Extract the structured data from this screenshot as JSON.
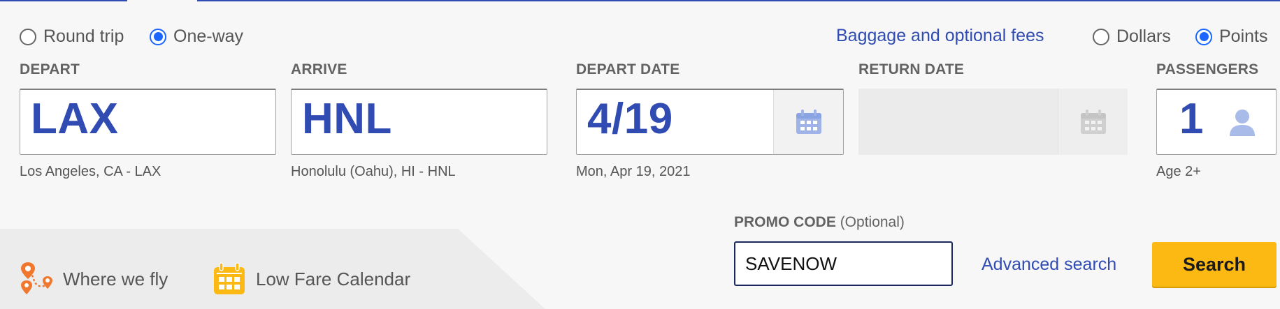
{
  "trip_type": {
    "options": [
      {
        "label": "Round trip",
        "selected": false
      },
      {
        "label": "One-way",
        "selected": true
      }
    ]
  },
  "baggage_link": "Baggage and optional fees",
  "currency": {
    "options": [
      {
        "label": "Dollars",
        "selected": false
      },
      {
        "label": "Points",
        "selected": true
      }
    ]
  },
  "depart": {
    "label": "DEPART",
    "value": "LAX",
    "description": "Los Angeles, CA - LAX"
  },
  "arrive": {
    "label": "ARRIVE",
    "value": "HNL",
    "description": "Honolulu (Oahu), HI - HNL"
  },
  "depart_date": {
    "label": "DEPART DATE",
    "value": "4/19",
    "description": "Mon, Apr 19, 2021"
  },
  "return_date": {
    "label": "RETURN DATE",
    "value": ""
  },
  "passengers": {
    "label": "PASSENGERS",
    "value": "1",
    "description": "Age 2+"
  },
  "promo": {
    "label": "PROMO CODE",
    "optional": "(Optional)",
    "value": "SAVENOW"
  },
  "advanced_search": "Advanced search",
  "search_button": "Search",
  "quick_links": [
    {
      "label": "Where we fly",
      "icon": "route-pins-icon"
    },
    {
      "label": "Low Fare Calendar",
      "icon": "calendar-icon"
    }
  ],
  "colors": {
    "brand_blue": "#304cb2",
    "radio_blue": "#1a66ff",
    "search_yellow": "#fdb913",
    "route_orange": "#f0772d",
    "calendar_yellow": "#fdb913"
  }
}
